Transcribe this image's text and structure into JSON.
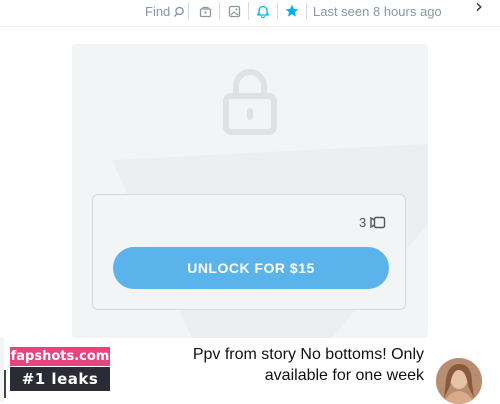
{
  "header": {
    "last_seen": "Last seen 8 hours ago",
    "find_label": "Find",
    "icons": [
      "chevron-right-icon",
      "search-icon",
      "tip-icon",
      "image-icon",
      "bell-icon",
      "star-icon"
    ]
  },
  "post": {
    "media_count": "3",
    "unlock_label": "UNLOCK FOR $15",
    "caption": "Ppv from story No bottoms! Only available for one week"
  },
  "watermark": {
    "site": "fapshots.com",
    "tagline": "#1 leaks"
  },
  "colors": {
    "accent": "#00aff0",
    "button": "#5ab3ea",
    "muted_text": "#8a96a3",
    "watermark_pink": "#e8437e",
    "watermark_dark": "#2b2b36"
  }
}
